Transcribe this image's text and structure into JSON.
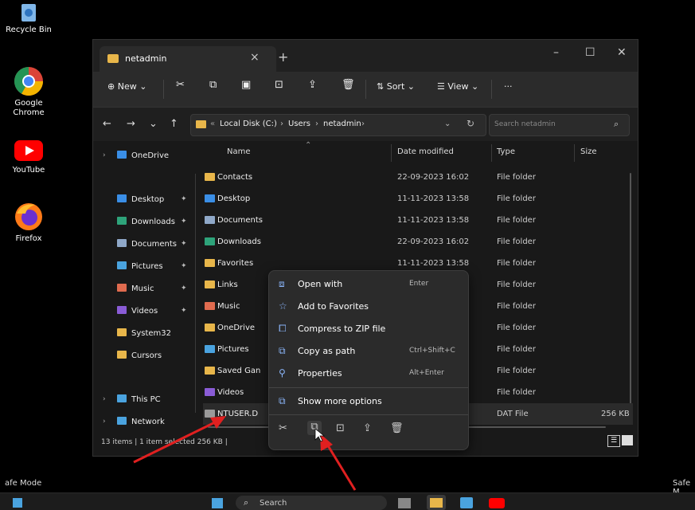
{
  "desktop": {
    "icons": [
      {
        "label": "Recycle Bin",
        "icon": "recycle-bin-icon"
      },
      {
        "label": "Google Chrome",
        "icon": "chrome-icon"
      },
      {
        "label": "YouTube",
        "icon": "youtube-icon"
      },
      {
        "label": "Firefox",
        "icon": "firefox-icon"
      }
    ],
    "safe_mode_left": "afe Mode",
    "safe_mode_right": "Safe M"
  },
  "window": {
    "tab_title": "netadmin",
    "toolbar": {
      "new_label": "New",
      "sort_label": "Sort",
      "view_label": "View",
      "more_label": "···"
    },
    "breadcrumb": [
      "Local Disk (C:)",
      "Users",
      "netadmin"
    ],
    "search_placeholder": "Search netadmin",
    "sidebar": [
      {
        "label": "OneDrive",
        "color": "#3a8ee6"
      },
      {
        "label": "Desktop",
        "color": "#3a8ee6",
        "pinned": true
      },
      {
        "label": "Downloads",
        "color": "#2ea37a",
        "pinned": true
      },
      {
        "label": "Documents",
        "color": "#8fa8c8",
        "pinned": true
      },
      {
        "label": "Pictures",
        "color": "#4aa3df",
        "pinned": true
      },
      {
        "label": "Music",
        "color": "#e06b4f",
        "pinned": true
      },
      {
        "label": "Videos",
        "color": "#8a5cd6",
        "pinned": true
      },
      {
        "label": "System32",
        "color": "#e8b64a"
      },
      {
        "label": "Cursors",
        "color": "#e8b64a"
      },
      {
        "label": "This PC",
        "color": "#4aa3df"
      },
      {
        "label": "Network",
        "color": "#4aa3df"
      }
    ],
    "columns": {
      "name": "Name",
      "date": "Date modified",
      "type": "Type",
      "size": "Size"
    },
    "files": [
      {
        "name": "Contacts",
        "date": "22-09-2023 16:02",
        "type": "File folder",
        "size": "",
        "color": "#e8b64a"
      },
      {
        "name": "Desktop",
        "date": "11-11-2023 13:58",
        "type": "File folder",
        "size": "",
        "color": "#3a8ee6"
      },
      {
        "name": "Documents",
        "date": "11-11-2023 13:58",
        "type": "File folder",
        "size": "",
        "color": "#8fa8c8"
      },
      {
        "name": "Downloads",
        "date": "22-09-2023 16:02",
        "type": "File folder",
        "size": "",
        "color": "#2ea37a"
      },
      {
        "name": "Favorites",
        "date": "11-11-2023 13:58",
        "type": "File folder",
        "size": "",
        "color": "#e8b64a"
      },
      {
        "name": "Links",
        "date": "",
        "type": "File folder",
        "size": "",
        "color": "#e8b64a"
      },
      {
        "name": "Music",
        "date": "",
        "type": "File folder",
        "size": "",
        "color": "#e06b4f"
      },
      {
        "name": "OneDrive",
        "date": "",
        "type": "File folder",
        "size": "",
        "color": "#e8b64a"
      },
      {
        "name": "Pictures",
        "date": "",
        "type": "File folder",
        "size": "",
        "color": "#4aa3df"
      },
      {
        "name": "Saved Gan",
        "date": "",
        "type": "File folder",
        "size": "",
        "color": "#e8b64a"
      },
      {
        "name": "Videos",
        "date": "",
        "type": "File folder",
        "size": "",
        "color": "#8a5cd6"
      },
      {
        "name": "NTUSER.D",
        "date": "",
        "type": "DAT File",
        "size": "256 KB",
        "color": "#9a9a9a"
      }
    ],
    "status": "13 items  |  1 item selected  256 KB  |"
  },
  "context_menu": {
    "items": [
      {
        "label": "Open with",
        "shortcut": "Enter",
        "icon": "open-with-icon"
      },
      {
        "label": "Add to Favorites",
        "shortcut": "",
        "icon": "star-icon"
      },
      {
        "label": "Compress to ZIP file",
        "shortcut": "",
        "icon": "zip-icon"
      },
      {
        "label": "Copy as path",
        "shortcut": "Ctrl+Shift+C",
        "icon": "copy-path-icon"
      },
      {
        "label": "Properties",
        "shortcut": "Alt+Enter",
        "icon": "wrench-icon"
      },
      {
        "label": "Show more options",
        "shortcut": "",
        "icon": "more-options-icon"
      }
    ]
  },
  "taskbar": {
    "search_label": "Search"
  }
}
